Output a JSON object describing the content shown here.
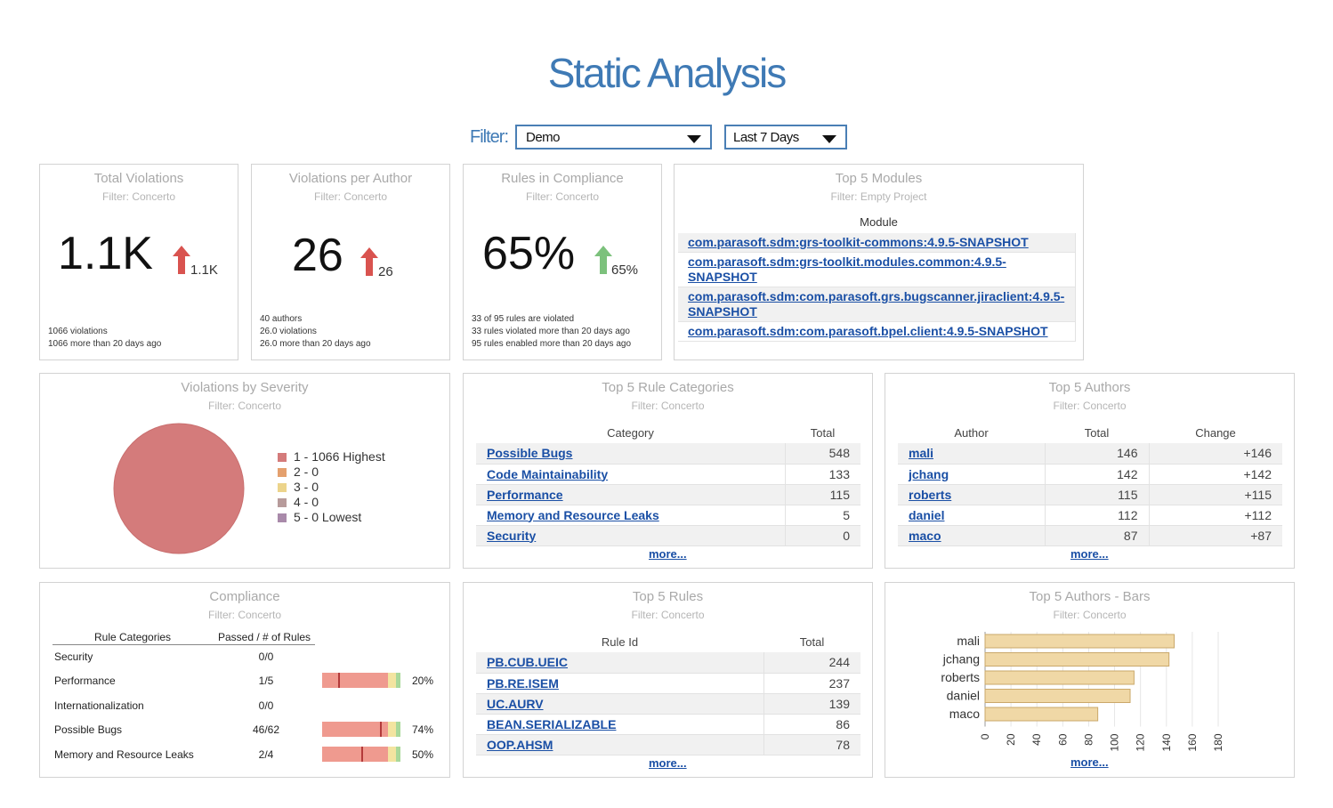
{
  "page_title": "Static Analysis",
  "filter": {
    "label": "Filter:",
    "project": "Demo",
    "period": "Last 7 Days"
  },
  "total_violations": {
    "title": "Total Violations",
    "filter": "Filter: Concerto",
    "value": "1.1K",
    "change": "1.1K",
    "direction": "up",
    "lines": [
      "1066 violations",
      "1066 more than 20 days ago"
    ]
  },
  "violations_per_author": {
    "title": "Violations per Author",
    "filter": "Filter: Concerto",
    "value": "26",
    "change": "26",
    "direction": "up",
    "lines": [
      "40 authors",
      "26.0 violations",
      "26.0 more than 20 days ago"
    ]
  },
  "rules_in_compliance": {
    "title": "Rules in Compliance",
    "filter": "Filter: Concerto",
    "value": "65%",
    "change": "65%",
    "direction": "up",
    "lines": [
      "33 of 95 rules are violated",
      "33 rules violated more than 20 days ago",
      "95 rules enabled more than 20 days ago"
    ]
  },
  "top_modules": {
    "title": "Top 5 Modules",
    "filter": "Filter: Empty Project",
    "header": "Module",
    "rows": [
      "com.parasoft.sdm:grs-toolkit-commons:4.9.5-SNAPSHOT",
      "com.parasoft.sdm:grs-toolkit.modules.common:4.9.5-SNAPSHOT",
      "com.parasoft.sdm:com.parasoft.grs.bugscanner.jiraclient:4.9.5-SNAPSHOT",
      "com.parasoft.sdm:com.parasoft.bpel.client:4.9.5-SNAPSHOT"
    ]
  },
  "severity": {
    "title": "Violations by Severity",
    "filter": "Filter: Concerto",
    "legend": [
      {
        "label": "1 - 1066 Highest",
        "color": "#d47b7b",
        "value": 1066
      },
      {
        "label": "2 - 0",
        "color": "#e4a06e",
        "value": 0
      },
      {
        "label": "3 - 0",
        "color": "#ecd48b",
        "value": 0
      },
      {
        "label": "4 - 0",
        "color": "#b79b9b",
        "value": 0
      },
      {
        "label": "5 - 0 Lowest",
        "color": "#a98aaa",
        "value": 0
      }
    ]
  },
  "rule_categories": {
    "title": "Top 5 Rule Categories",
    "filter": "Filter: Concerto",
    "col_category": "Category",
    "col_total": "Total",
    "rows": [
      {
        "name": "Possible Bugs",
        "total": "548"
      },
      {
        "name": "Code Maintainability",
        "total": "133"
      },
      {
        "name": "Performance",
        "total": "115"
      },
      {
        "name": "Memory and Resource Leaks",
        "total": "5"
      },
      {
        "name": "Security",
        "total": "0"
      }
    ],
    "more": "more..."
  },
  "top_authors": {
    "title": "Top 5 Authors",
    "filter": "Filter: Concerto",
    "col_author": "Author",
    "col_total": "Total",
    "col_change": "Change",
    "rows": [
      {
        "name": "mali",
        "total": "146",
        "change": "+146"
      },
      {
        "name": "jchang",
        "total": "142",
        "change": "+142"
      },
      {
        "name": "roberts",
        "total": "115",
        "change": "+115"
      },
      {
        "name": "daniel",
        "total": "112",
        "change": "+112"
      },
      {
        "name": "maco",
        "total": "87",
        "change": "+87"
      }
    ],
    "more": "more..."
  },
  "compliance": {
    "title": "Compliance",
    "filter": "Filter: Concerto",
    "col_category": "Rule Categories",
    "col_passed": "Passed / # of Rules",
    "rows": [
      {
        "name": "Security",
        "passed": "0/0",
        "pct": null,
        "pct_label": ""
      },
      {
        "name": "Performance",
        "passed": "1/5",
        "pct": 20,
        "pct_label": "20%"
      },
      {
        "name": "Internationalization",
        "passed": "0/0",
        "pct": null,
        "pct_label": ""
      },
      {
        "name": "Possible Bugs",
        "passed": "46/62",
        "pct": 74,
        "pct_label": "74%"
      },
      {
        "name": "Memory and Resource Leaks",
        "passed": "2/4",
        "pct": 50,
        "pct_label": "50%"
      }
    ]
  },
  "top_rules": {
    "title": "Top 5 Rules",
    "filter": "Filter: Concerto",
    "col_rule": "Rule Id",
    "col_total": "Total",
    "rows": [
      {
        "name": "PB.CUB.UEIC",
        "total": "244"
      },
      {
        "name": "PB.RE.ISEM",
        "total": "237"
      },
      {
        "name": "UC.AURV",
        "total": "139"
      },
      {
        "name": "BEAN.SERIALIZABLE",
        "total": "86"
      },
      {
        "name": "OOP.AHSM",
        "total": "78"
      }
    ],
    "more": "more..."
  },
  "authors_bars": {
    "title": "Top 5 Authors - Bars",
    "filter": "Filter: Concerto",
    "more": "more...",
    "chart_data": {
      "type": "bar",
      "orientation": "horizontal",
      "categories": [
        "mali",
        "jchang",
        "roberts",
        "daniel",
        "maco"
      ],
      "values": [
        146,
        142,
        115,
        112,
        87
      ],
      "xlim": [
        0,
        180
      ],
      "xticks": [
        "0",
        "20",
        "40",
        "60",
        "80",
        "100",
        "120",
        "140",
        "160",
        "180"
      ],
      "bar_color": "#f0d8a6",
      "grid": true
    }
  }
}
